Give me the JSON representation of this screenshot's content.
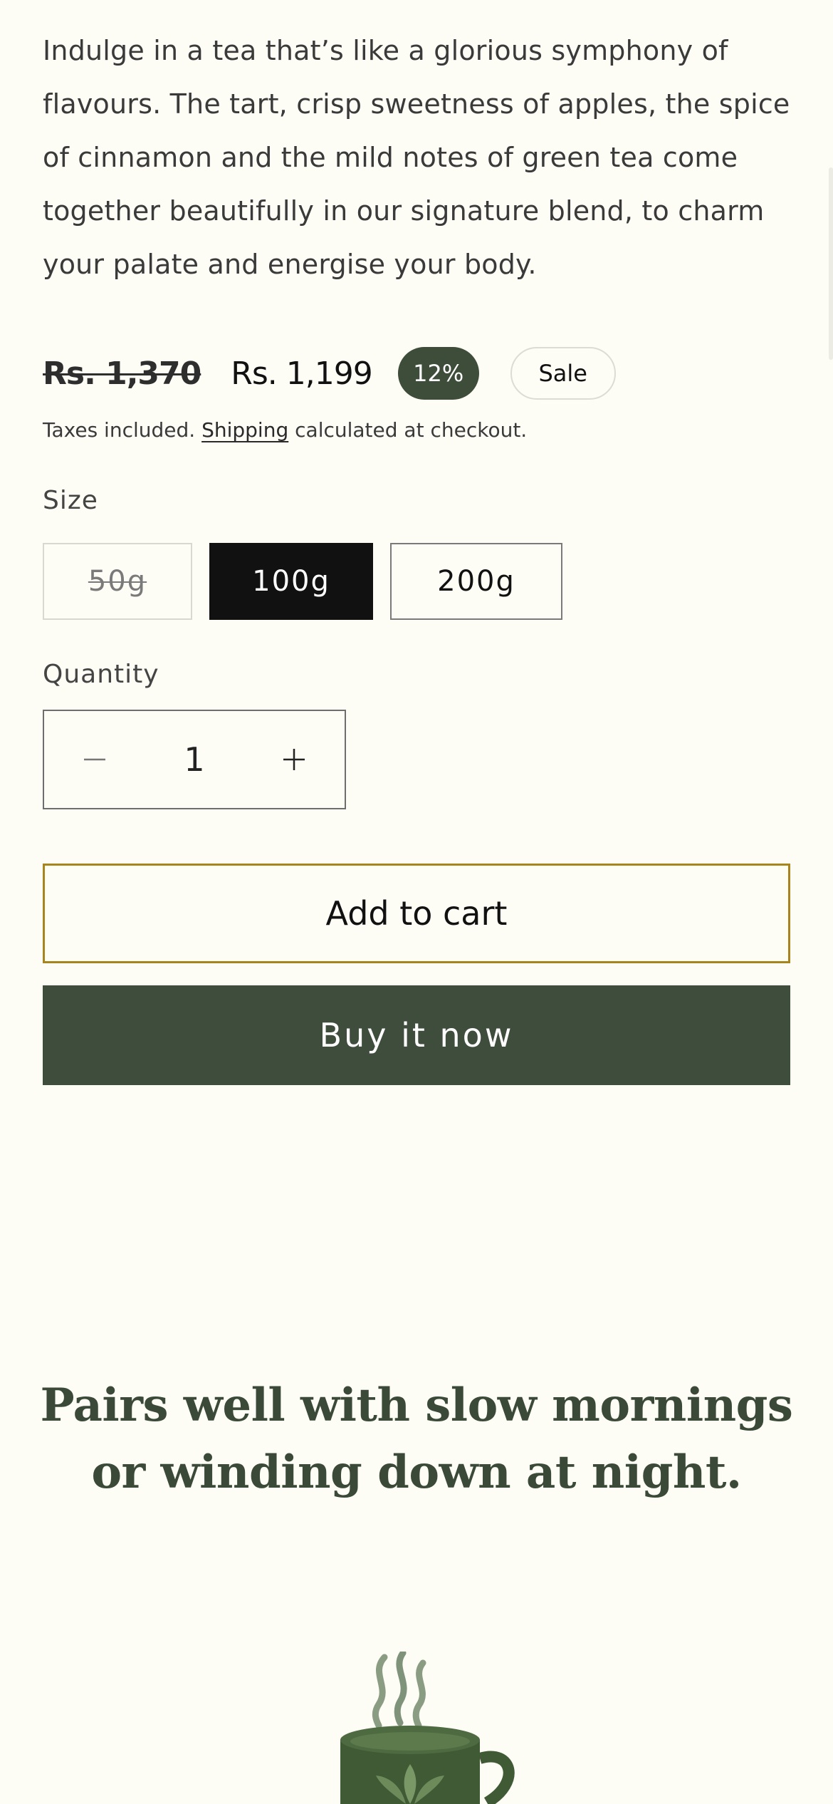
{
  "product": {
    "description": "Indulge in a tea that’s like a glorious symphony of flavours. The tart, crisp sweetness of apples, the spice of cinnamon and the mild notes of green tea come together beautifully in our signature blend, to charm your palate and energise your body.",
    "price_old": "Rs. 1,370",
    "price_new": "Rs. 1,199",
    "discount_badge": "12%",
    "sale_badge": "Sale",
    "tax_note_prefix": "Taxes included.",
    "tax_note_link": "Shipping",
    "tax_note_suffix": "calculated at checkout."
  },
  "size": {
    "label": "Size",
    "options": [
      {
        "label": "50g",
        "state": "unavailable"
      },
      {
        "label": "100g",
        "state": "selected"
      },
      {
        "label": "200g",
        "state": "available"
      }
    ]
  },
  "quantity": {
    "label": "Quantity",
    "value": "1"
  },
  "actions": {
    "add_to_cart": "Add to cart",
    "buy_now": "Buy it now"
  },
  "tagline": "Pairs well with slow mornings or winding down at night.",
  "icons": {
    "minus": "minus-icon",
    "plus": "plus-icon",
    "illustration": "tea-cup-illustration"
  },
  "colors": {
    "accent_green": "#3f4e3c",
    "cart_border": "#a7841e",
    "background": "#fdfcf5",
    "selected_size": "#111111"
  }
}
